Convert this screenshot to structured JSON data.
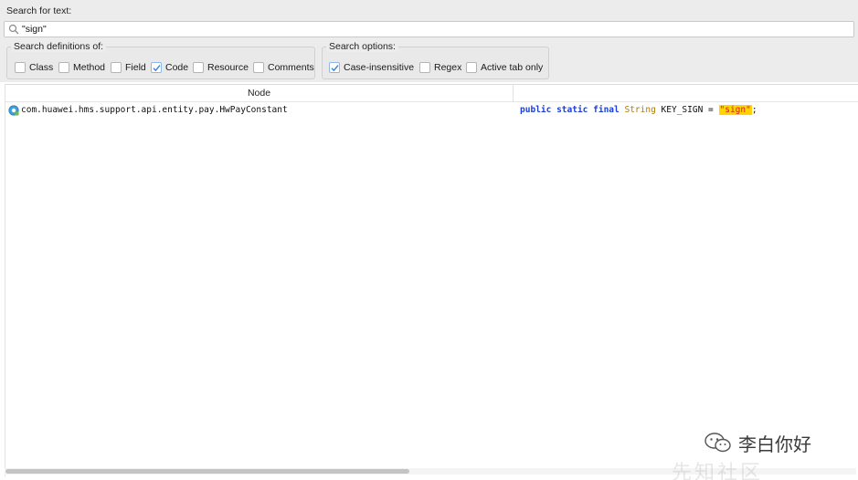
{
  "search": {
    "label": "Search for text:",
    "value": "\"sign\""
  },
  "definitions": {
    "title": "Search definitions of:",
    "options": [
      {
        "label": "Class",
        "checked": false
      },
      {
        "label": "Method",
        "checked": false
      },
      {
        "label": "Field",
        "checked": false
      },
      {
        "label": "Code",
        "checked": true
      },
      {
        "label": "Resource",
        "checked": false
      },
      {
        "label": "Comments",
        "checked": false
      }
    ]
  },
  "search_options": {
    "title": "Search options:",
    "options": [
      {
        "label": "Case-insensitive",
        "checked": true
      },
      {
        "label": "Regex",
        "checked": false
      },
      {
        "label": "Active tab only",
        "checked": false
      }
    ]
  },
  "results": {
    "columns": [
      "Node",
      ""
    ],
    "rows": [
      {
        "node": "com.huawei.hms.support.api.entity.pay.HwPayConstant",
        "code": {
          "kw1": "public",
          "kw2": "static",
          "kw3": "final",
          "type": "String",
          "name": "KEY_SIGN",
          "eq": "=",
          "literal": "\"sign\"",
          "end": ";"
        }
      }
    ]
  },
  "watermark": {
    "text": "李白你好",
    "faded": "先知社区"
  },
  "colors": {
    "keyword": "#1d3fd0",
    "type": "#b07a0b",
    "highlight_bg": "#ffd400",
    "highlight_fg": "#d32020",
    "checkbox_check": "#3b82d6"
  }
}
